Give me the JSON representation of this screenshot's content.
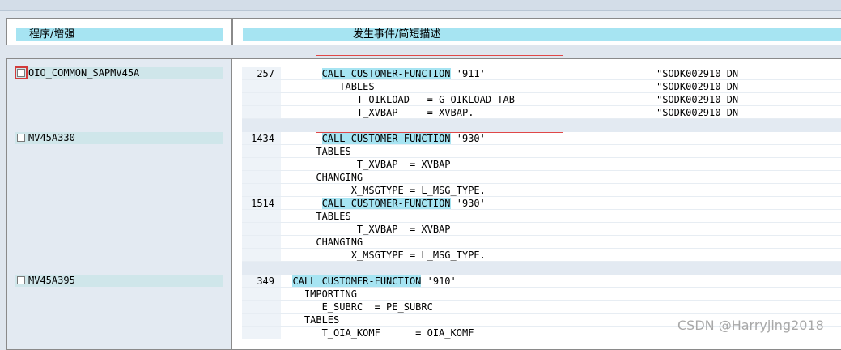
{
  "header": {
    "left_label": "程序/增强",
    "right_label": "发生事件/简短描述"
  },
  "programs": [
    {
      "name": "OIO_COMMON_SAPMV45A",
      "checked": false,
      "focused": true
    },
    {
      "name": "MV45A330",
      "checked": false
    },
    {
      "name": "MV45A395",
      "checked": false
    }
  ],
  "blocks": [
    {
      "lines": [
        {
          "num": "257",
          "pre": "       ",
          "hl": "CALL CUSTOMER-FUNCTION",
          "post": " '911'",
          "comment": "\"SODK002910 DN"
        },
        {
          "num": "",
          "pre": "          TABLES",
          "hl": "",
          "post": "",
          "comment": "\"SODK002910 DN"
        },
        {
          "num": "",
          "pre": "             T_OIKLOAD   = G_OIKLOAD_TAB",
          "hl": "",
          "post": "",
          "comment": "\"SODK002910 DN"
        },
        {
          "num": "",
          "pre": "             T_XVBAP     = XVBAP.",
          "hl": "",
          "post": "",
          "comment": "\"SODK002910 DN"
        }
      ]
    },
    {
      "lines": [
        {
          "num": "1434",
          "pre": "       ",
          "hl": "CALL CUSTOMER-FUNCTION",
          "post": " '930'",
          "comment": ""
        },
        {
          "num": "",
          "pre": "      TABLES",
          "hl": "",
          "post": "",
          "comment": ""
        },
        {
          "num": "",
          "pre": "             T_XVBAP  = XVBAP",
          "hl": "",
          "post": "",
          "comment": ""
        },
        {
          "num": "",
          "pre": "      CHANGING",
          "hl": "",
          "post": "",
          "comment": ""
        },
        {
          "num": "",
          "pre": "            X_MSGTYPE = L_MSG_TYPE.",
          "hl": "",
          "post": "",
          "comment": ""
        },
        {
          "num": "1514",
          "pre": "       ",
          "hl": "CALL CUSTOMER-FUNCTION",
          "post": " '930'",
          "comment": ""
        },
        {
          "num": "",
          "pre": "      TABLES",
          "hl": "",
          "post": "",
          "comment": ""
        },
        {
          "num": "",
          "pre": "             T_XVBAP  = XVBAP",
          "hl": "",
          "post": "",
          "comment": ""
        },
        {
          "num": "",
          "pre": "      CHANGING",
          "hl": "",
          "post": "",
          "comment": ""
        },
        {
          "num": "",
          "pre": "            X_MSGTYPE = L_MSG_TYPE.",
          "hl": "",
          "post": "",
          "comment": ""
        }
      ]
    },
    {
      "lines": [
        {
          "num": "349",
          "pre": "  ",
          "hl": "CALL CUSTOMER-FUNCTION",
          "post": " '910'",
          "comment": ""
        },
        {
          "num": "",
          "pre": "    IMPORTING",
          "hl": "",
          "post": "",
          "comment": ""
        },
        {
          "num": "",
          "pre": "       E_SUBRC  = PE_SUBRC",
          "hl": "",
          "post": "",
          "comment": ""
        },
        {
          "num": "",
          "pre": "    TABLES",
          "hl": "",
          "post": "",
          "comment": ""
        },
        {
          "num": "",
          "pre": "       T_OIA_KOMF      = OIA_KOMF",
          "hl": "",
          "post": "",
          "comment": ""
        }
      ]
    }
  ],
  "watermark": "CSDN @Harryjing2018"
}
